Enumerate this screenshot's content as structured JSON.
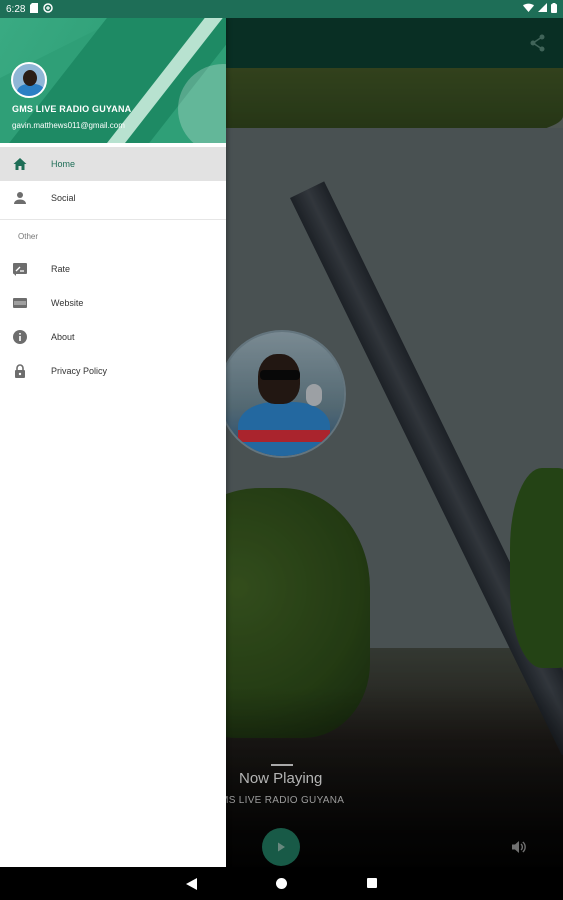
{
  "status_bar": {
    "time": "6:28",
    "icons": [
      "sd-card-icon",
      "data-saver-icon",
      "wifi-icon",
      "signal-icon",
      "battery-icon"
    ]
  },
  "app": {
    "now_playing_title": "Now Playing",
    "station_name": "GMS LIVE RADIO GUYANA"
  },
  "drawer": {
    "user_name": "GMS LIVE RADIO GUYANA",
    "user_email": "gavin.matthews011@gmail.com",
    "primary_items": [
      {
        "label": "Home",
        "icon": "home-icon",
        "active": true
      },
      {
        "label": "Social",
        "icon": "person-icon",
        "active": false
      }
    ],
    "section_label": "Other",
    "secondary_items": [
      {
        "label": "Rate",
        "icon": "rate-icon"
      },
      {
        "label": "Website",
        "icon": "web-icon"
      },
      {
        "label": "About",
        "icon": "info-icon"
      },
      {
        "label": "Privacy Policy",
        "icon": "lock-icon"
      }
    ]
  },
  "colors": {
    "primary": "#1e6e57",
    "header": "#2f9f77",
    "active_bg": "#e2e2e2"
  }
}
